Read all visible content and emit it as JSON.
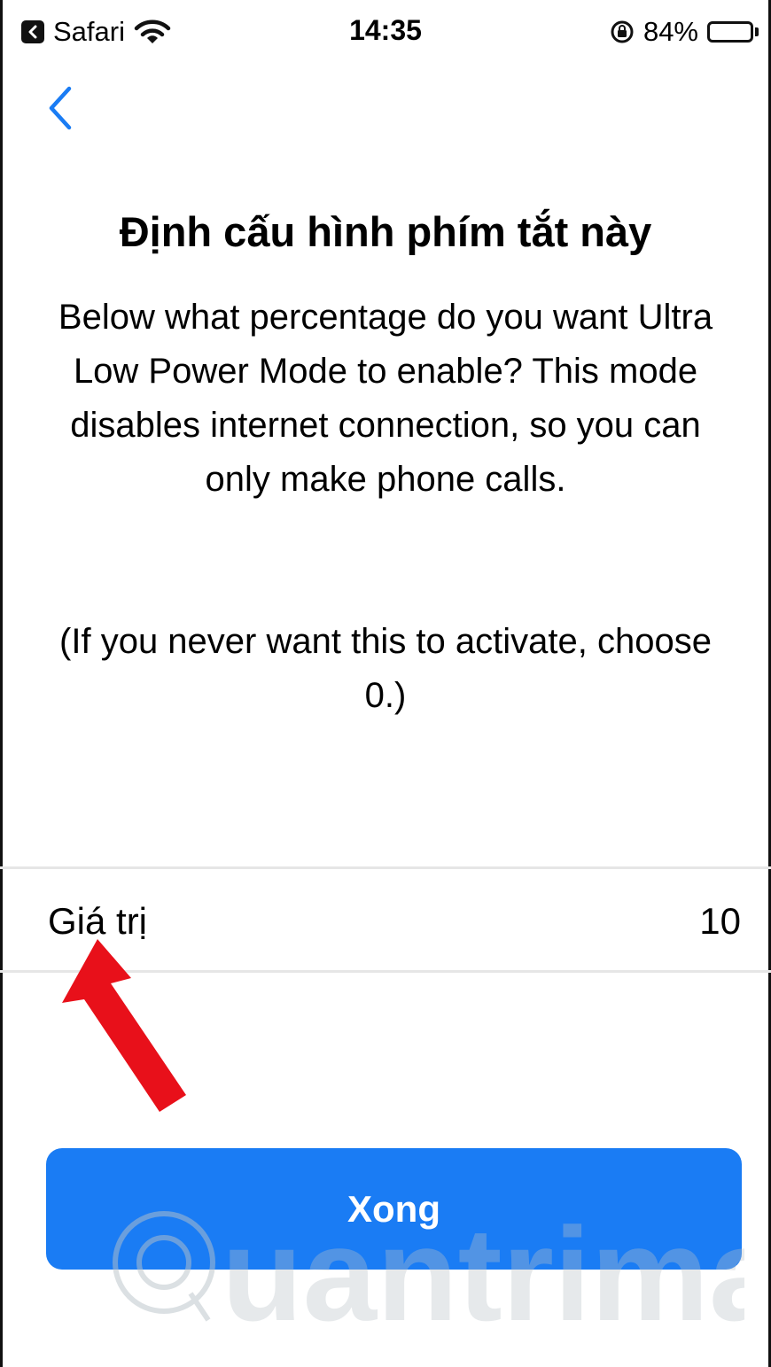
{
  "status_bar": {
    "back_app": "Safari",
    "time": "14:35",
    "battery_percent": "84%",
    "battery_level": 0.84,
    "icons": [
      "back-to-app-icon",
      "wifi-icon",
      "orientation-lock-icon",
      "battery-icon"
    ]
  },
  "nav": {
    "back_icon": "chevron-left-icon"
  },
  "title": "Định cấu hình phím tắt này",
  "description": "Below what percentage do you want Ultra Low Power Mode to enable? This mode disables internet connection, so you can only make phone calls.",
  "note": "(If you never want this to activate, choose 0.)",
  "value_row": {
    "label": "Giá trị",
    "value": "10"
  },
  "done_button": {
    "label": "Xong"
  },
  "watermark": {
    "brand": "Quantrimang"
  },
  "colors": {
    "accent": "#1a7cf4",
    "annotation_arrow": "#e8101a"
  }
}
